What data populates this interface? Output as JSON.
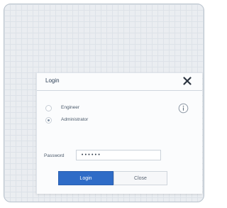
{
  "dialog": {
    "title": "Login",
    "close_icon": "close-icon",
    "info_icon": "info-icon",
    "roles": [
      {
        "label": "Engineer",
        "selected": false
      },
      {
        "label": "Administrator",
        "selected": true
      }
    ],
    "password": {
      "label": "Password",
      "value": "••••••"
    },
    "buttons": {
      "login": "Login",
      "close": "Close"
    }
  },
  "colors": {
    "accent": "#2f6cc7",
    "grid_background": "#eaedf1"
  }
}
